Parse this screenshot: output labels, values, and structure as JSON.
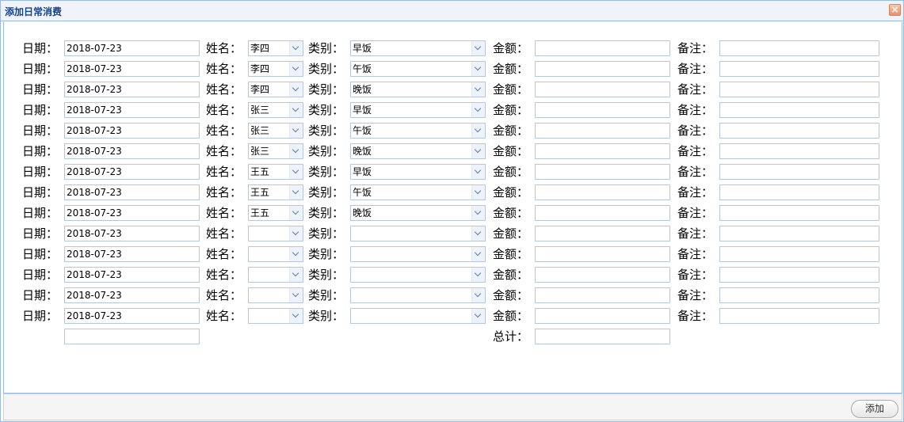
{
  "window": {
    "title": "添加日常消费",
    "close_glyph": "×"
  },
  "labels": {
    "date": "日期：",
    "name": "姓名：",
    "category": "类别：",
    "amount": "金额：",
    "note": "备注：",
    "total": "总计："
  },
  "rows": [
    {
      "date": "2018-07-23",
      "name": "李四",
      "category": "早饭",
      "amount": "",
      "note": ""
    },
    {
      "date": "2018-07-23",
      "name": "李四",
      "category": "午饭",
      "amount": "",
      "note": ""
    },
    {
      "date": "2018-07-23",
      "name": "李四",
      "category": "晚饭",
      "amount": "",
      "note": ""
    },
    {
      "date": "2018-07-23",
      "name": "张三",
      "category": "早饭",
      "amount": "",
      "note": ""
    },
    {
      "date": "2018-07-23",
      "name": "张三",
      "category": "午饭",
      "amount": "",
      "note": ""
    },
    {
      "date": "2018-07-23",
      "name": "张三",
      "category": "晚饭",
      "amount": "",
      "note": ""
    },
    {
      "date": "2018-07-23",
      "name": "王五",
      "category": "早饭",
      "amount": "",
      "note": ""
    },
    {
      "date": "2018-07-23",
      "name": "王五",
      "category": "午饭",
      "amount": "",
      "note": ""
    },
    {
      "date": "2018-07-23",
      "name": "王五",
      "category": "晚饭",
      "amount": "",
      "note": ""
    },
    {
      "date": "2018-07-23",
      "name": "",
      "category": "",
      "amount": "",
      "note": ""
    },
    {
      "date": "2018-07-23",
      "name": "",
      "category": "",
      "amount": "",
      "note": ""
    },
    {
      "date": "2018-07-23",
      "name": "",
      "category": "",
      "amount": "",
      "note": ""
    },
    {
      "date": "2018-07-23",
      "name": "",
      "category": "",
      "amount": "",
      "note": ""
    },
    {
      "date": "2018-07-23",
      "name": "",
      "category": "",
      "amount": "",
      "note": ""
    }
  ],
  "summary": {
    "left_field": "",
    "total": ""
  },
  "footer": {
    "add_label": "添加"
  }
}
